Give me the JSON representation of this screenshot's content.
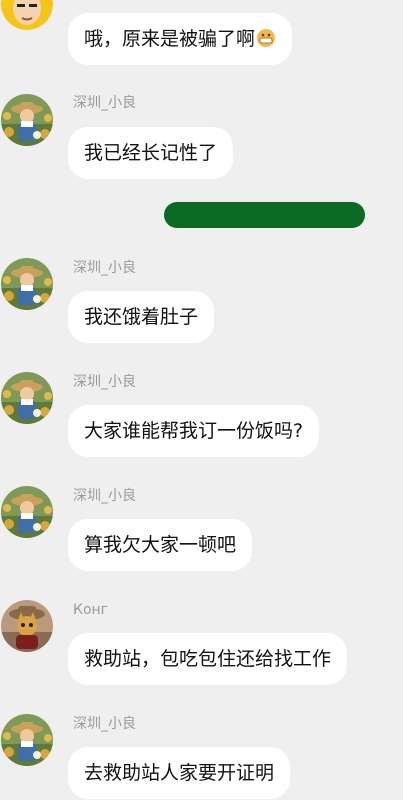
{
  "messages": [
    {
      "sender": "",
      "text": "哦，原来是被骗了啊",
      "emoji": "grimace-emoji"
    },
    {
      "sender": "深圳_小良",
      "text": "我已经长记性了"
    },
    {
      "sender": "深圳_小良",
      "text": "我还饿着肚子"
    },
    {
      "sender": "深圳_小良",
      "text": "大家谁能帮我订一份饭吗?"
    },
    {
      "sender": "深圳_小良",
      "text": "算我欠大家一顿吧"
    },
    {
      "sender": "Конг",
      "text": "救助站，包吃包住还给找工作"
    },
    {
      "sender": "深圳_小良",
      "text": "去救助站人家要开证明"
    }
  ],
  "redaction": {
    "color": "#0b6b24"
  }
}
